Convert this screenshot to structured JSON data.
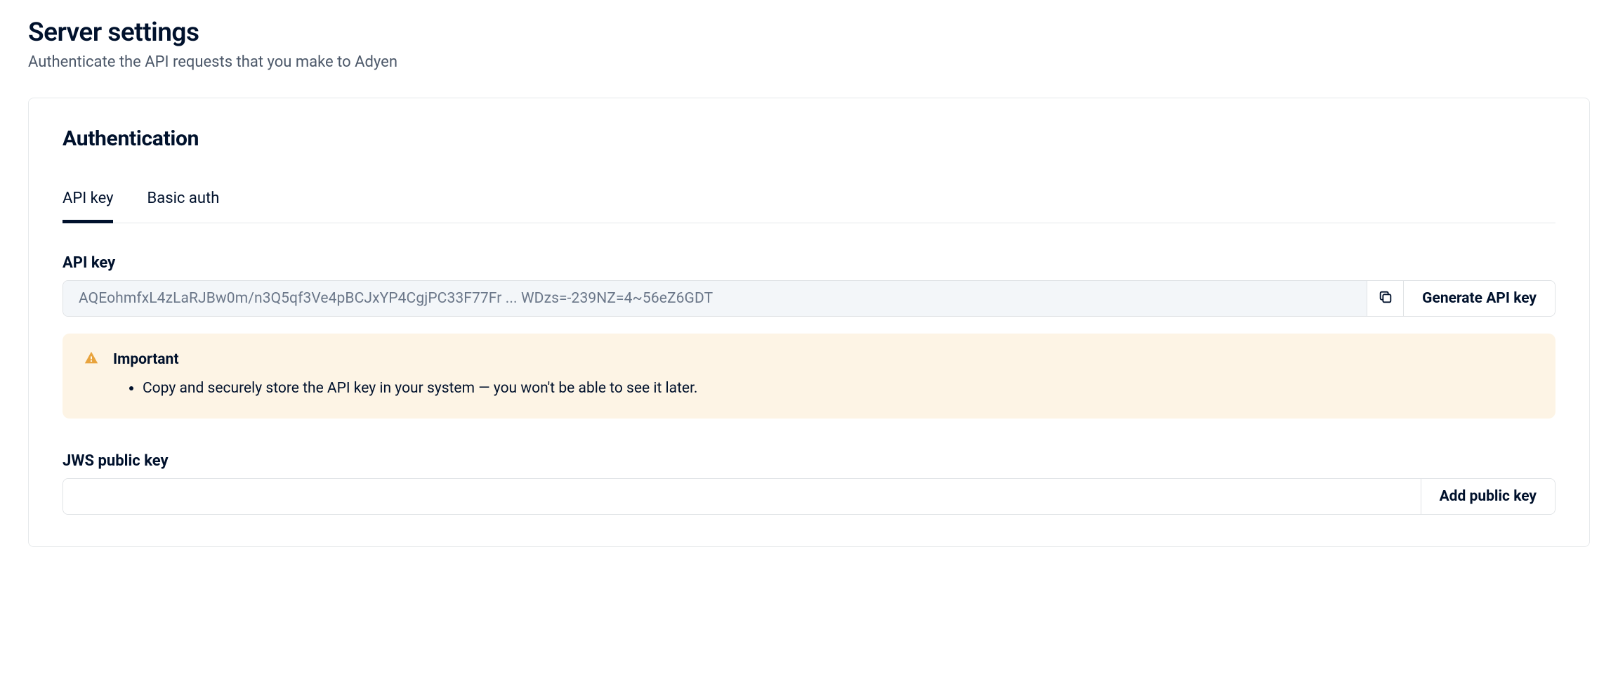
{
  "page": {
    "title": "Server settings",
    "subtitle": "Authenticate the API requests that you make to Adyen"
  },
  "card": {
    "title": "Authentication",
    "tabs": [
      {
        "label": "API key",
        "active": true
      },
      {
        "label": "Basic auth",
        "active": false
      }
    ],
    "apiKey": {
      "label": "API key",
      "value": "AQEohmfxL4zLaRJBw0m/n3Q5qf3Ve4pBCJxYP4CgjPC33F77Fr ... WDzs=-239NZ=4~56eZ6GDT",
      "copyIcon": "copy-icon",
      "generateLabel": "Generate API key"
    },
    "alert": {
      "icon": "warning-icon",
      "title": "Important",
      "items": [
        "Copy and securely store the API key in your system — you won't be able to see it later."
      ]
    },
    "jws": {
      "label": "JWS public key",
      "addLabel": "Add public key"
    }
  }
}
